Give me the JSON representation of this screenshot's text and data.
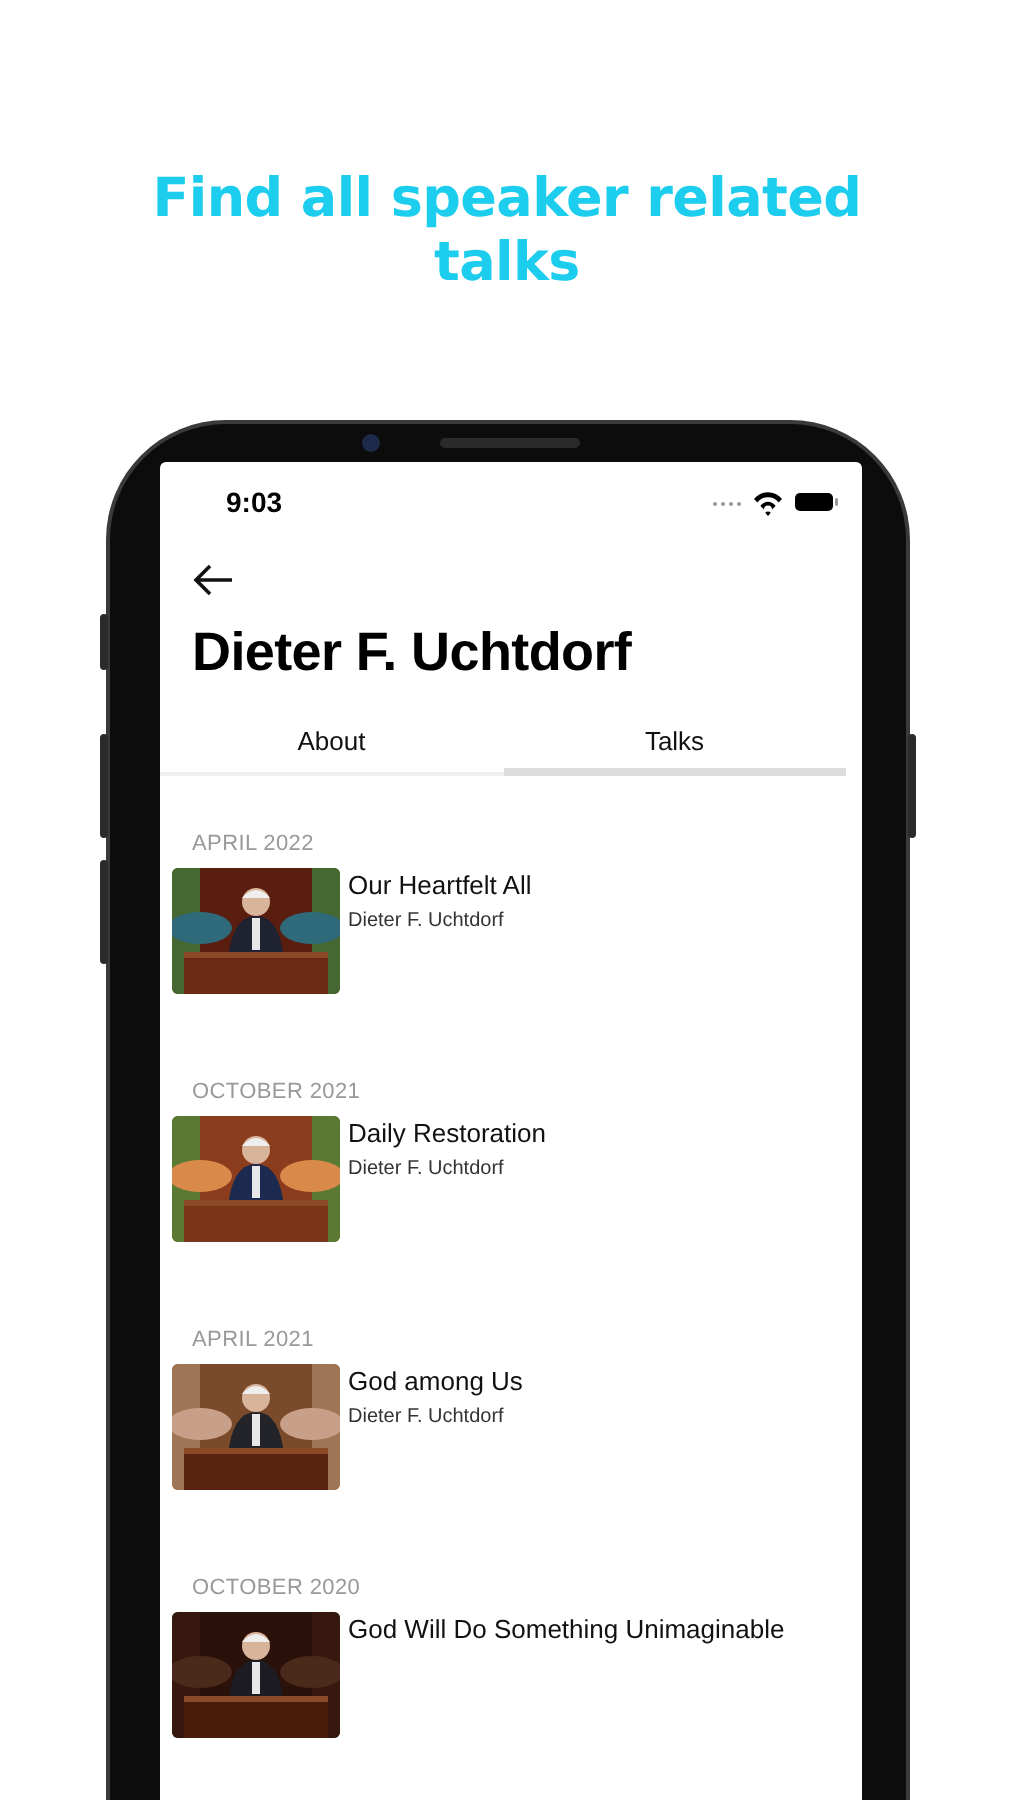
{
  "headline": "Find all speaker related talks",
  "status_bar": {
    "time": "9:03"
  },
  "title": "Dieter F. Uchtdorf",
  "tabs": [
    {
      "label": "About",
      "selected": false
    },
    {
      "label": "Talks",
      "selected": true
    }
  ],
  "sections": [
    {
      "heading": "APRIL 2022",
      "talks": [
        {
          "title": "Our Heartfelt All",
          "speaker": "Dieter F. Uchtdorf"
        }
      ]
    },
    {
      "heading": "OCTOBER 2021",
      "talks": [
        {
          "title": "Daily Restoration",
          "speaker": "Dieter F. Uchtdorf"
        }
      ]
    },
    {
      "heading": "APRIL 2021",
      "talks": [
        {
          "title": "God among Us",
          "speaker": "Dieter F. Uchtdorf"
        }
      ]
    },
    {
      "heading": "OCTOBER 2020",
      "talks": [
        {
          "title": "God Will Do Something Unimaginable"
        }
      ]
    }
  ]
}
